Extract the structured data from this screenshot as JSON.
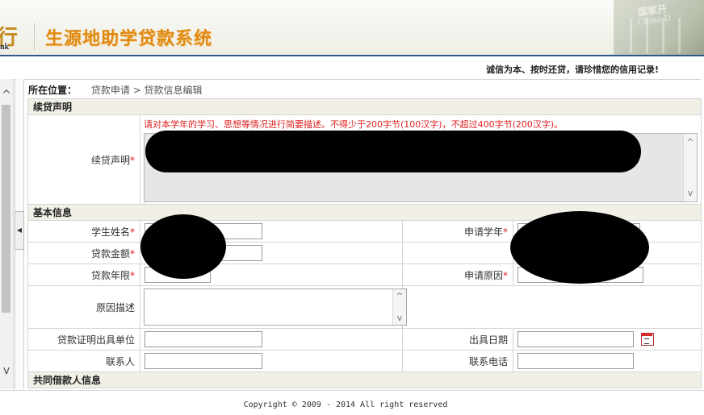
{
  "header": {
    "logo_char": "行",
    "logo_sub": "nk",
    "system_title": "生源地助学贷款系统",
    "building_text": "国家开",
    "building_text2": "China D"
  },
  "slogan": "诚信为本、按时还贷，请珍惜您的信用记录!",
  "breadcrumb": {
    "label": "所在位置：",
    "path": "贷款申请 > 贷款信息编辑"
  },
  "sections": {
    "renewal": "续贷声明",
    "basic": "基本信息",
    "coborrower": "共同借款人信息"
  },
  "renewal": {
    "hint": "请对本学年的学习、思想等情况进行简要描述。不得少于200字节(100汉字)，不超过400字节(200汉字)。",
    "label": "续贷声明",
    "required_mark": "*"
  },
  "basic": {
    "student_name_label": "学生姓名",
    "loan_amount_label": "贷款金额",
    "loan_term_label": "贷款年限",
    "apply_year_label": "申请学年",
    "apply_reason_label": "申请原因",
    "reason_desc_label": "原因描述",
    "cert_unit_label": "贷款证明出具单位",
    "issue_date_label": "出具日期",
    "contact_label": "联系人",
    "contact_phone_label": "联系电话",
    "required_mark": "*"
  },
  "footer": {
    "copyright": "Copyright © 2009 - 2014 All right reserved"
  },
  "icons": {
    "scroll_up": "^",
    "scroll_down": "v",
    "collapse": "◀",
    "calendar": "calendar-icon"
  },
  "colors": {
    "title_orange": "#e08a12",
    "required_red": "#e02020",
    "section_bg": "#f1efe6",
    "header_border": "#2c5a86"
  }
}
